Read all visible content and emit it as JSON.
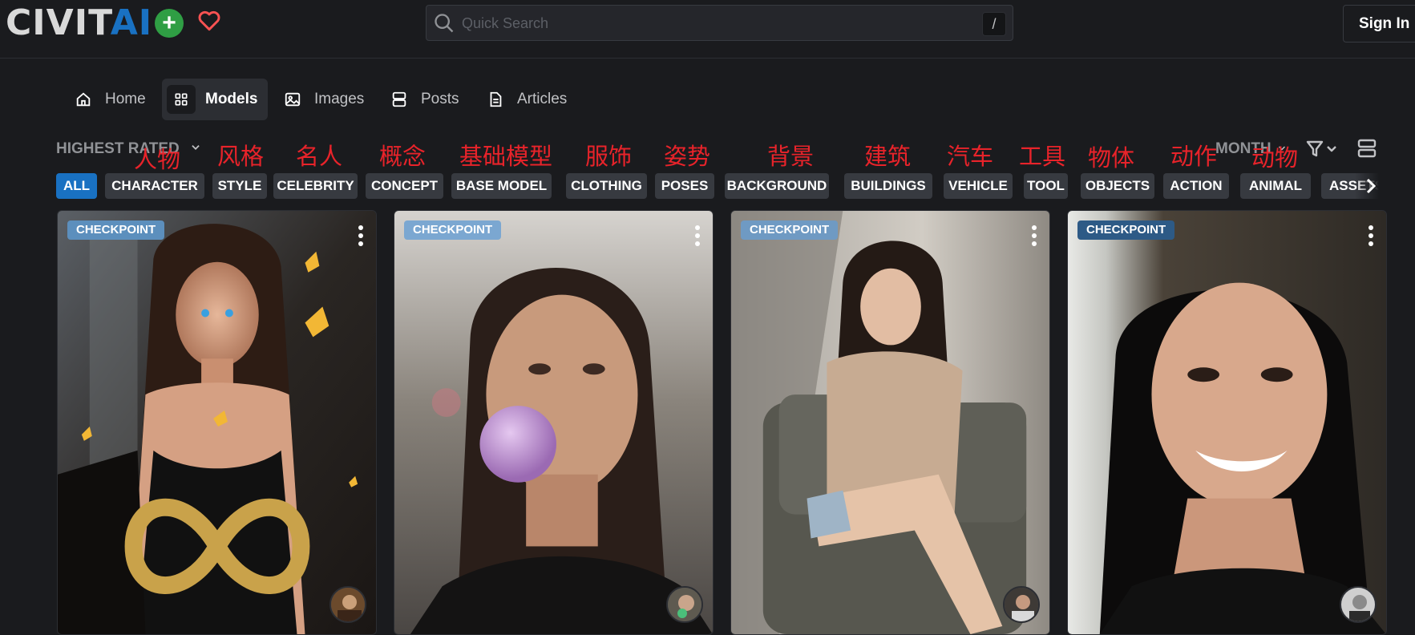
{
  "header": {
    "logo_civ": "CIVIT",
    "logo_ai": "AI",
    "search_placeholder": "Quick Search",
    "search_shortcut": "/",
    "sign_in": "Sign In"
  },
  "nav": [
    {
      "label": "Home",
      "icon": "home-icon"
    },
    {
      "label": "Models",
      "icon": "grid-icon",
      "active": true
    },
    {
      "label": "Images",
      "icon": "image-icon"
    },
    {
      "label": "Posts",
      "icon": "posts-icon"
    },
    {
      "label": "Articles",
      "icon": "article-icon"
    }
  ],
  "sort": {
    "label": "HIGHEST RATED"
  },
  "period": {
    "label": "MONTH"
  },
  "annotations": [
    "人物",
    "风格",
    "名人",
    "概念",
    "基础模型",
    "服饰",
    "姿势",
    "背景",
    "建筑",
    "汽车",
    "工具",
    "物体",
    "动作",
    "动物"
  ],
  "categories": [
    "ALL",
    "CHARACTER",
    "STYLE",
    "CELEBRITY",
    "CONCEPT",
    "BASE MODEL",
    "CLOTHING",
    "POSES",
    "BACKGROUND",
    "BUILDINGS",
    "VEHICLE",
    "TOOL",
    "OBJECTS",
    "ACTION",
    "ANIMAL",
    "ASSETS"
  ],
  "active_category": "ALL",
  "cards": [
    {
      "badge": "CHECKPOINT",
      "badge_color": "#5c8fbd"
    },
    {
      "badge": "CHECKPOINT",
      "badge_color": "#7ba7d1"
    },
    {
      "badge": "CHECKPOINT",
      "badge_color": "#6f9ac3"
    },
    {
      "badge": "CHECKPOINT",
      "badge_color": "#2d5a86"
    }
  ],
  "colors": {
    "accent": "#1971c2",
    "annotation": "#e8232a",
    "plus": "#2f9e44",
    "heart": "#fa5252"
  }
}
